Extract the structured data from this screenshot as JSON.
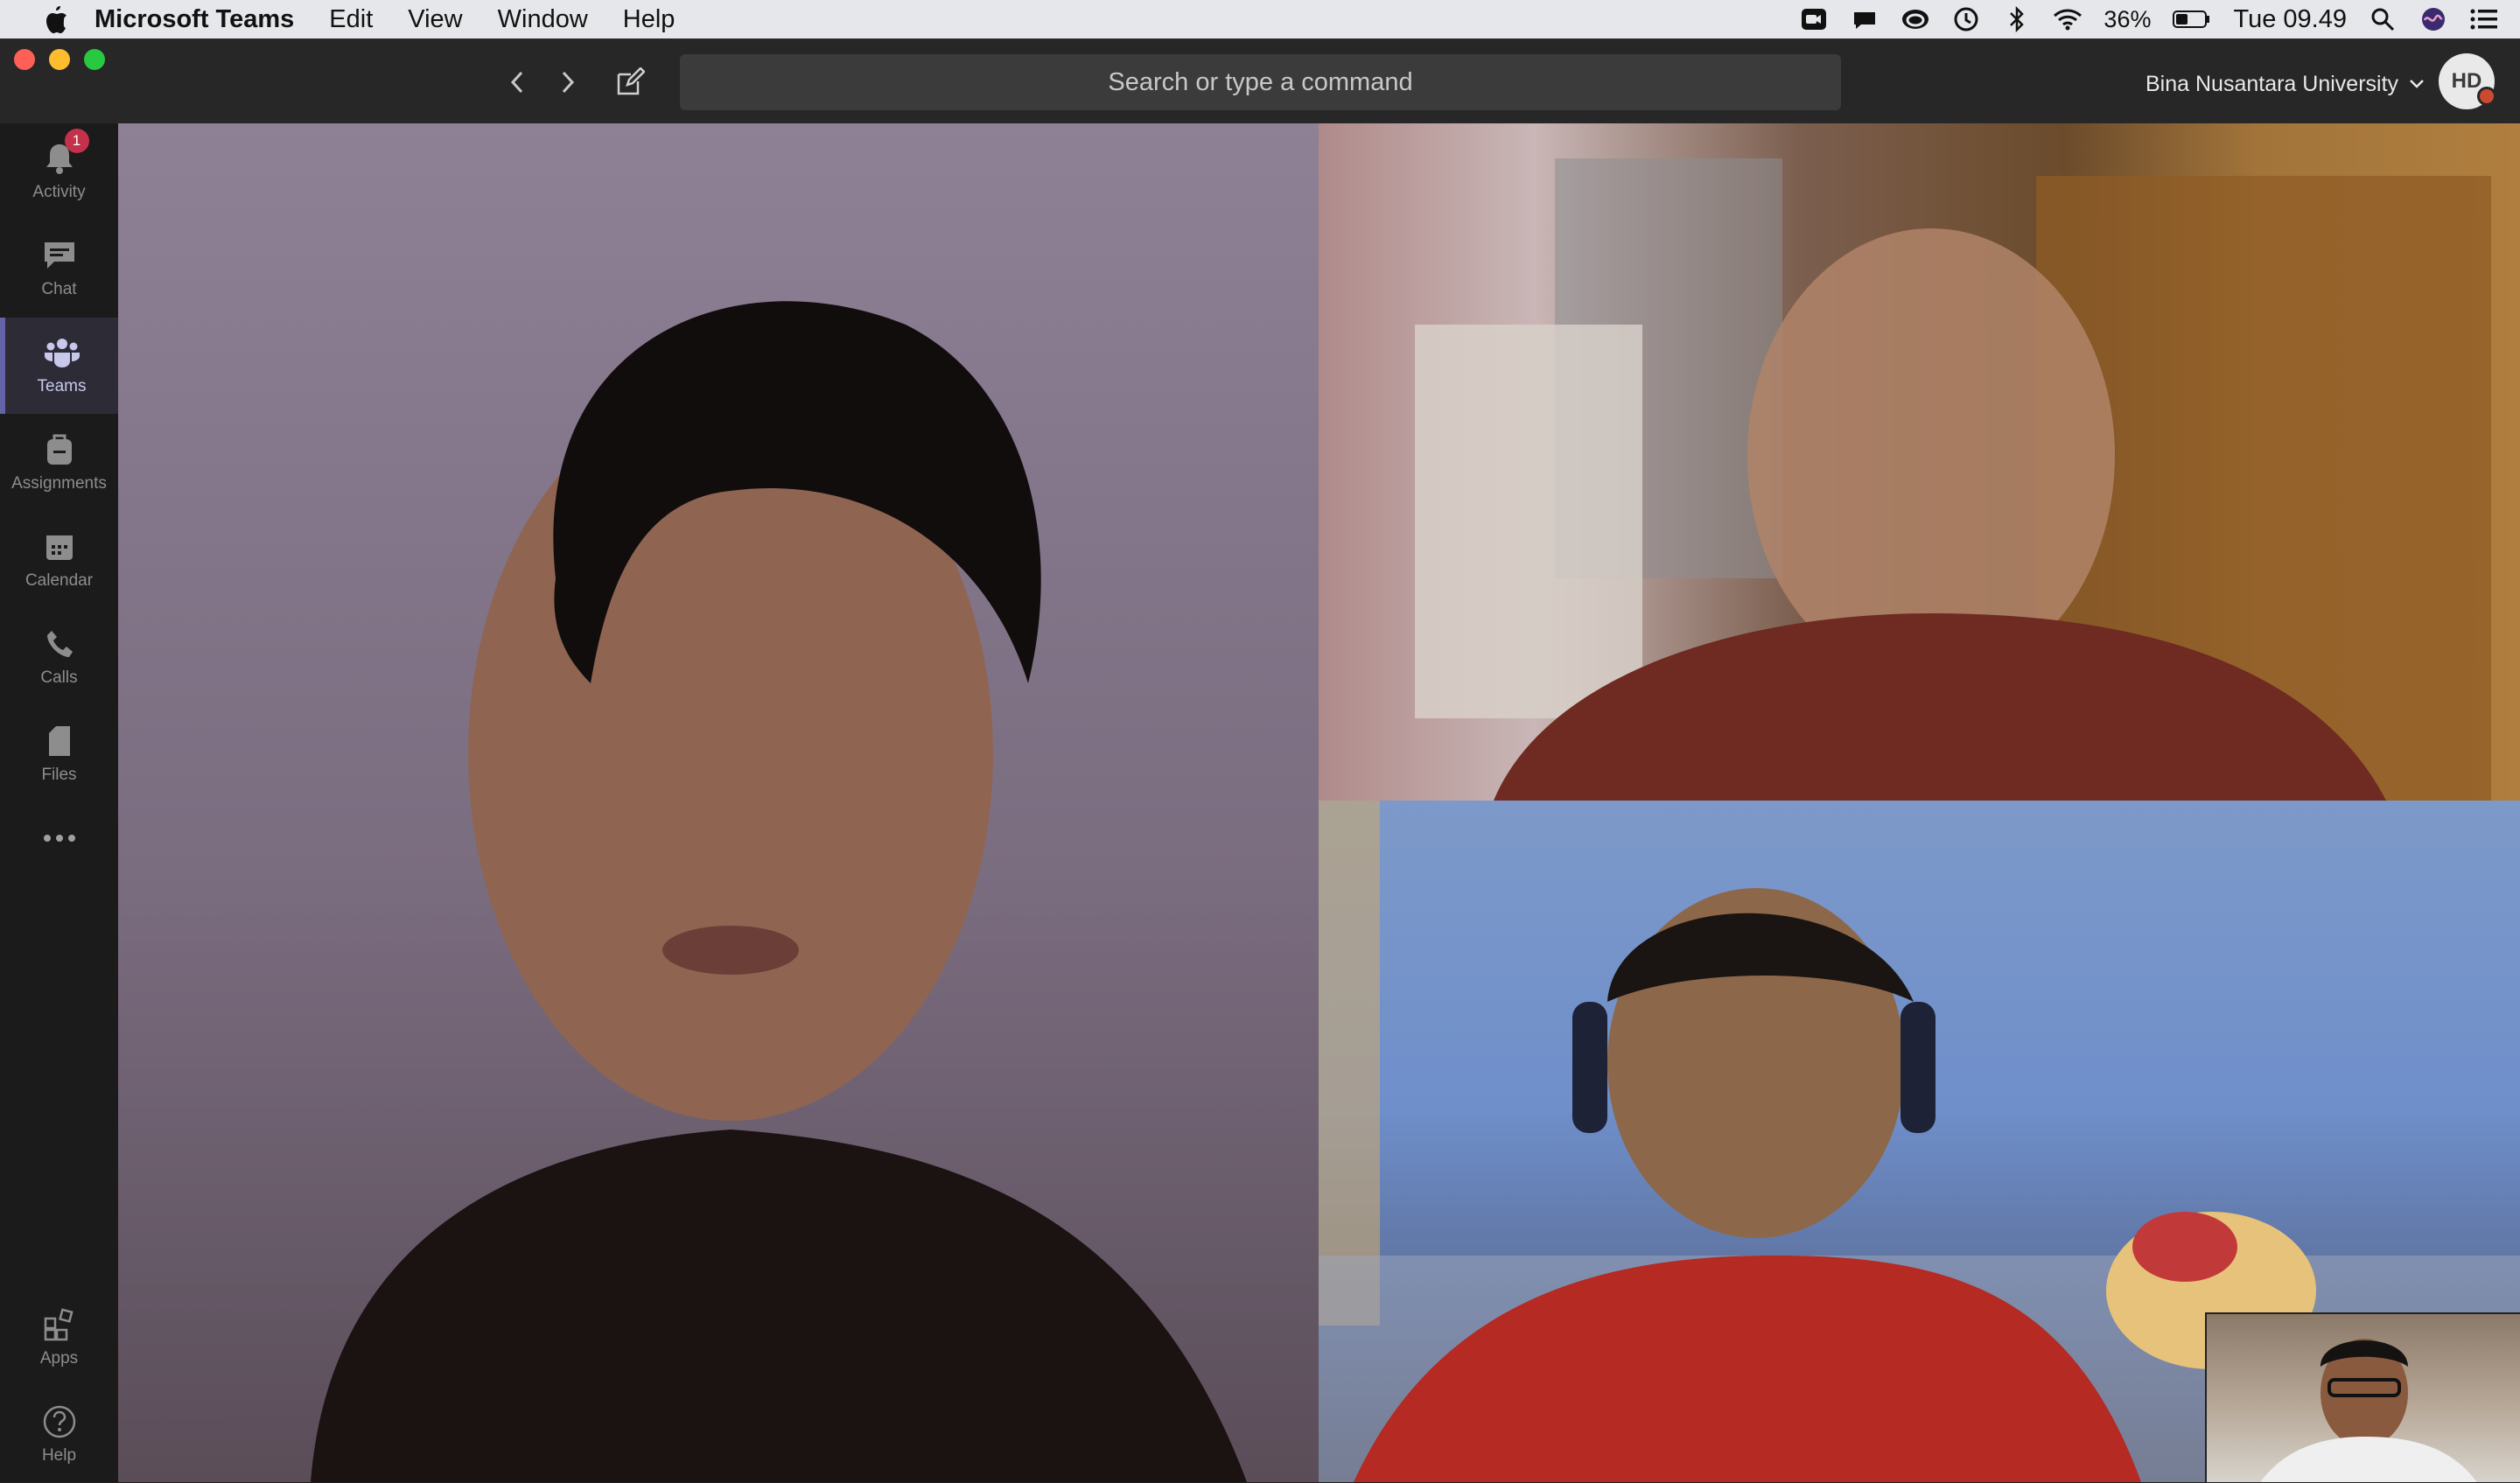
{
  "menubar": {
    "app_name": "Microsoft Teams",
    "menus": [
      "Edit",
      "View",
      "Window",
      "Help"
    ],
    "battery": "36%",
    "clock": "Tue 09.49"
  },
  "toolbar": {
    "search_placeholder": "Search or type a command",
    "org_name": "Bina Nusantara University",
    "avatar_initials": "HD"
  },
  "rail": {
    "items": [
      {
        "label": "Activity",
        "badge": "1"
      },
      {
        "label": "Chat"
      },
      {
        "label": "Teams"
      },
      {
        "label": "Assignments"
      },
      {
        "label": "Calendar"
      },
      {
        "label": "Calls"
      },
      {
        "label": "Files"
      },
      {
        "label": "Apps"
      },
      {
        "label": "Help"
      }
    ],
    "active": "Teams"
  },
  "colors": {
    "accent": "#6264a7",
    "badge": "#c4314b"
  }
}
